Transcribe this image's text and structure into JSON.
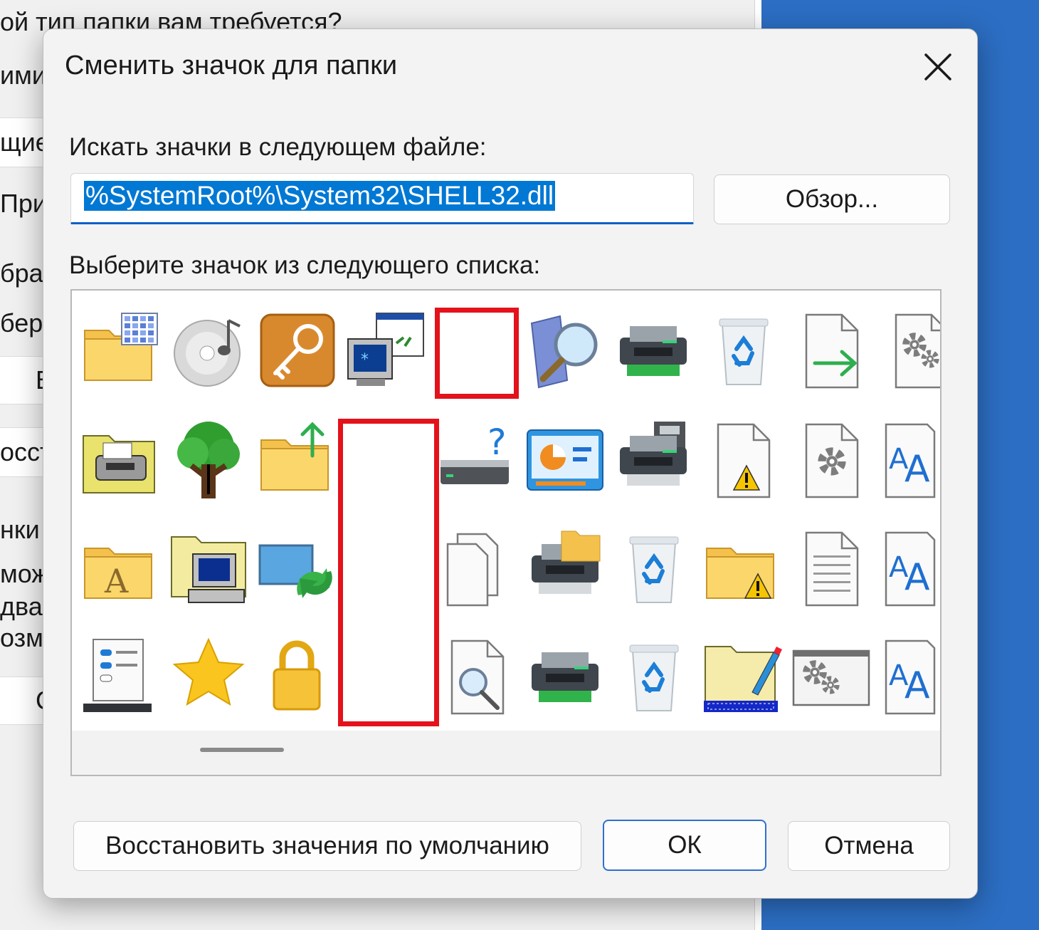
{
  "background": {
    "top_text": "ой тип папки вам требуется?",
    "rows": [
      "ими",
      "щие",
      "При",
      "бра",
      "бери",
      "В",
      "осст",
      "нки",
      "мож",
      "двар",
      "озм",
      "С"
    ]
  },
  "dialog": {
    "title": "Сменить значок для папки",
    "close_icon": "close-icon",
    "search_label": "Искать значки в следующем файле:",
    "path_value": "%SystemRoot%\\System32\\SHELL32.dll",
    "browse_label": "Обзор...",
    "list_label": "Выберите значок из следующего списка:",
    "restore_label": "Восстановить значения по умолчанию",
    "ok_label": "ОК",
    "cancel_label": "Отмена"
  },
  "icons": [
    [
      "folder-grid-icon",
      "cd-audio-icon",
      "key-icon",
      "network-computer-icon",
      "blank-icon",
      "search-globe-icon",
      "printer-icon",
      "recycle-bin-full-icon",
      "file-arrow-icon",
      "settings-file-icon"
    ],
    [
      "printer-folder-icon",
      "tree-icon",
      "folder-up-icon",
      "blank-icon",
      "drive-unknown-icon",
      "control-panel-icon",
      "printer-fax-icon",
      "file-warning-icon",
      "gear-file-icon",
      "font-file-icon"
    ],
    [
      "font-folder-icon",
      "computer-folder-icon",
      "sync-monitor-icon",
      "blank-icon",
      "copy-files-icon",
      "printer-folder2-icon",
      "recycle-bin-icon",
      "folder-warning-icon",
      "text-file-icon",
      "font-file-icon"
    ],
    [
      "server-list-icon",
      "star-icon",
      "lock-icon",
      "blank-icon",
      "file-search-icon",
      "printer-green-icon",
      "recycle-bin-empty-icon",
      "folder-edit-icon",
      "window-gear-icon",
      "font-file-icon"
    ]
  ],
  "highlight_color": "#e3121b",
  "accent_color": "#0078d4"
}
